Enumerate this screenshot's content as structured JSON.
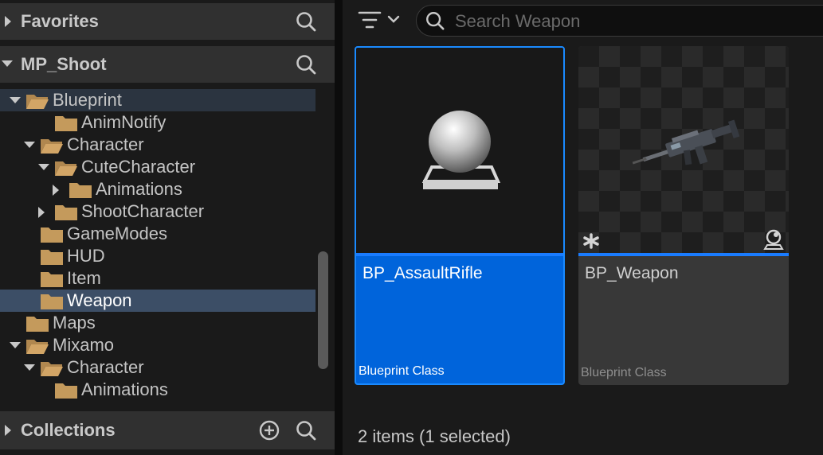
{
  "sidebar": {
    "favorites": {
      "title": "Favorites"
    },
    "project": {
      "title": "MP_Shoot"
    },
    "collections": {
      "title": "Collections"
    },
    "tree": [
      {
        "label": "Blueprint",
        "state": "open"
      },
      {
        "label": "AnimNotify",
        "state": "leaf"
      },
      {
        "label": "Character",
        "state": "open"
      },
      {
        "label": "CuteCharacter",
        "state": "open"
      },
      {
        "label": "Animations",
        "state": "closed"
      },
      {
        "label": "ShootCharacter",
        "state": "closed"
      },
      {
        "label": "GameModes",
        "state": "leaf"
      },
      {
        "label": "HUD",
        "state": "leaf"
      },
      {
        "label": "Item",
        "state": "leaf"
      },
      {
        "label": "Weapon",
        "state": "selected"
      },
      {
        "label": "Maps",
        "state": "leaf"
      },
      {
        "label": "Mixamo",
        "state": "open"
      },
      {
        "label": "Character",
        "state": "open"
      },
      {
        "label": "Animations",
        "state": "leaf"
      }
    ]
  },
  "toolbar": {
    "search_placeholder": "Search Weapon"
  },
  "assets": [
    {
      "name": "BP_AssaultRifle",
      "type": "Blueprint Class",
      "selected": true
    },
    {
      "name": "BP_Weapon",
      "type": "Blueprint Class",
      "selected": false
    }
  ],
  "status": {
    "text": "2 items (1 selected)"
  },
  "colors": {
    "selection": "#0064db",
    "folder": "#c49a5c",
    "panel": "#1a1a1a",
    "header": "#303030"
  },
  "icons": {
    "header_search": "search-icon",
    "add": "add-circle-icon",
    "filter": "filter-icon",
    "folder": "folder-icon"
  }
}
